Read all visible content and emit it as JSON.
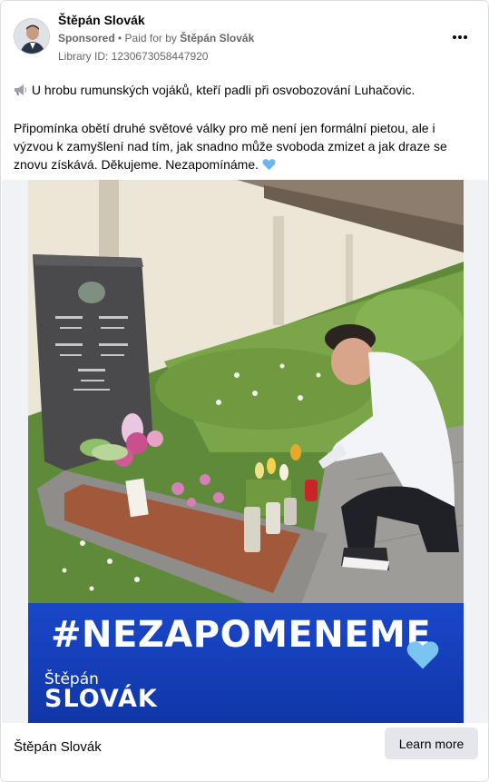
{
  "ad": {
    "page_name": "Štěpán Slovák",
    "sponsored_label": "Sponsored",
    "separator": " • ",
    "paid_for_prefix": "Paid for by ",
    "payer_name": "Štěpán Slovák",
    "library_id": "Library ID: 1230673058447920",
    "more_options_icon": "more-horizontal-icon"
  },
  "post": {
    "line1": "U hrobu rumunských vojáků, kteří padli při osvobozování Luhačovic.",
    "paragraph2": "Připomínka obětí druhé světové války pro mě není jen formální pietou, ale i výzvou k zamyšlení nad tím, jak snadno může svoboda zmizet a jak draze se znovu získává. Děkujeme. Nezapomínáme.",
    "leading_icon": "megaphone-icon",
    "trailing_icon": "blue-heart-icon"
  },
  "image": {
    "hashtag": "#NEZAPOMENEME",
    "brand_first": "Štěpán",
    "brand_last": "SLOVÁK",
    "banner_color": "#1a47c9"
  },
  "footer": {
    "name": "Štěpán Slovák",
    "cta_label": "Learn more"
  }
}
